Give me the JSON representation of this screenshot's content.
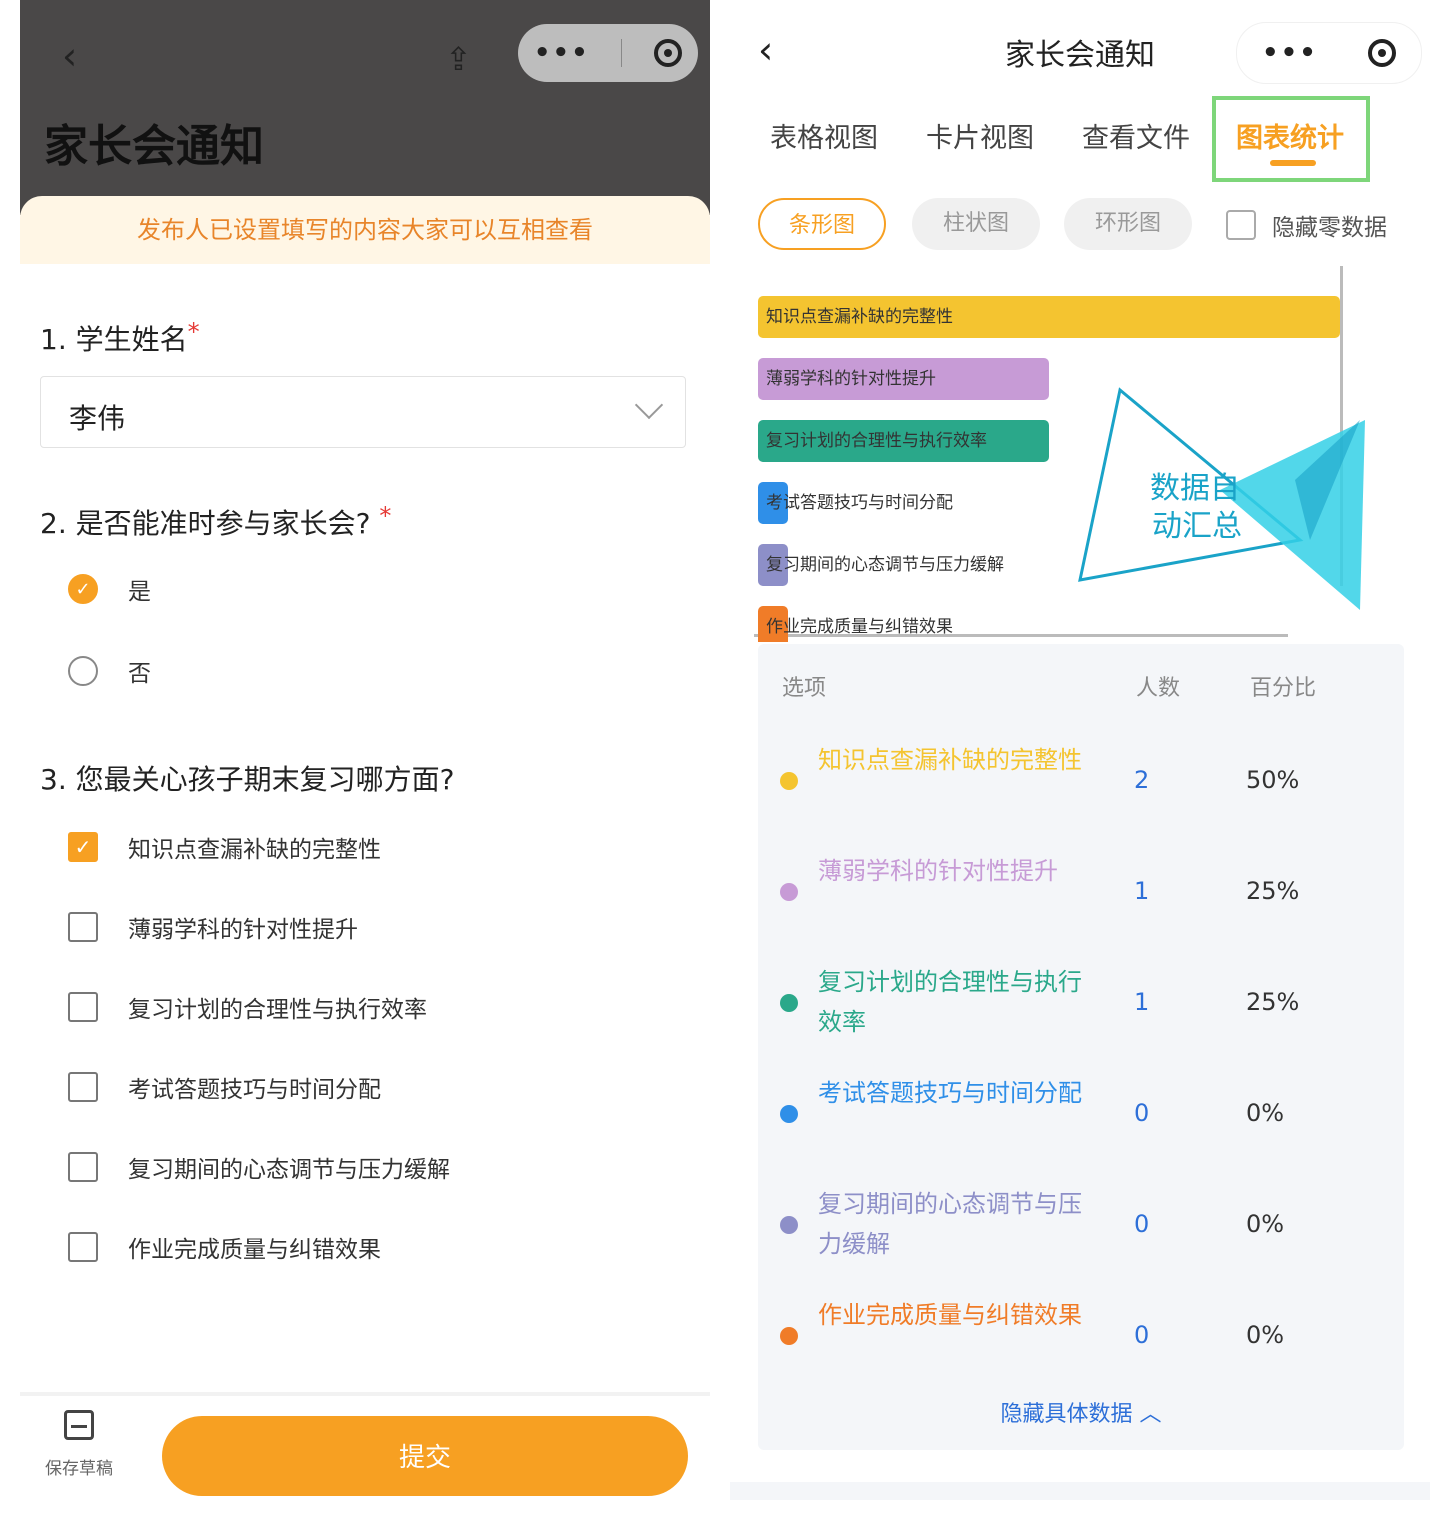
{
  "left": {
    "title": "家长会通知",
    "notice": "发布人已设置填写的内容大家可以互相查看",
    "q1": {
      "title": "1. 学生姓名",
      "required": "*",
      "value": "李伟"
    },
    "q2": {
      "title": "2. 是否能准时参与家长会?",
      "required": "*",
      "options": [
        "是",
        "否"
      ],
      "selected": "是"
    },
    "q3": {
      "title": "3. 您最关心孩子期末复习哪方面?",
      "options": [
        "知识点查漏补缺的完整性",
        "薄弱学科的针对性提升",
        "复习计划的合理性与执行效率",
        "考试答题技巧与时间分配",
        "复习期间的心态调节与压力缓解",
        "作业完成质量与纠错效果"
      ],
      "checked": "知识点查漏补缺的完整性"
    },
    "footer": {
      "draft_label": "保存草稿",
      "submit_label": "提交"
    }
  },
  "right": {
    "title": "家长会通知",
    "tabs": [
      "表格视图",
      "卡片视图",
      "查看文件",
      "图表统计"
    ],
    "active_tab": "图表统计",
    "chart_types": [
      "条形图",
      "柱状图",
      "环形图"
    ],
    "active_chart_type": "条形图",
    "hide_zero_label": "隐藏零数据",
    "badge_text": [
      "数据自",
      "动汇总"
    ],
    "table": {
      "headers": [
        "选项",
        "人数",
        "百分比"
      ],
      "rows": [
        {
          "name": "知识点查漏补缺的完整性",
          "count": "2",
          "pct": "50%",
          "color": "#f4c430"
        },
        {
          "name": "薄弱学科的针对性提升",
          "count": "1",
          "pct": "25%",
          "color": "#c79bd6"
        },
        {
          "name": "复习计划的合理性与执行效率",
          "count": "1",
          "pct": "25%",
          "color": "#2aa88a"
        },
        {
          "name": "考试答题技巧与时间分配",
          "count": "0",
          "pct": "0%",
          "color": "#2f8fe8"
        },
        {
          "name": "复习期间的心态调节与压力缓解",
          "count": "0",
          "pct": "0%",
          "color": "#8d8fc8"
        },
        {
          "name": "作业完成质量与纠错效果",
          "count": "0",
          "pct": "0%",
          "color": "#f07c28"
        }
      ],
      "toggle_label": "隐藏具体数据"
    }
  },
  "chart_data": {
    "type": "bar",
    "orientation": "horizontal",
    "categories": [
      "知识点查漏补缺的完整性",
      "薄弱学科的针对性提升",
      "复习计划的合理性与执行效率",
      "考试答题技巧与时间分配",
      "复习期间的心态调节与压力缓解",
      "作业完成质量与纠错效果"
    ],
    "values": [
      2,
      1,
      1,
      0,
      0,
      0
    ],
    "colors": [
      "#f4c430",
      "#c79bd6",
      "#2aa88a",
      "#2f8fe8",
      "#8d8fc8",
      "#f07c28"
    ],
    "xlim": [
      0,
      2
    ]
  }
}
